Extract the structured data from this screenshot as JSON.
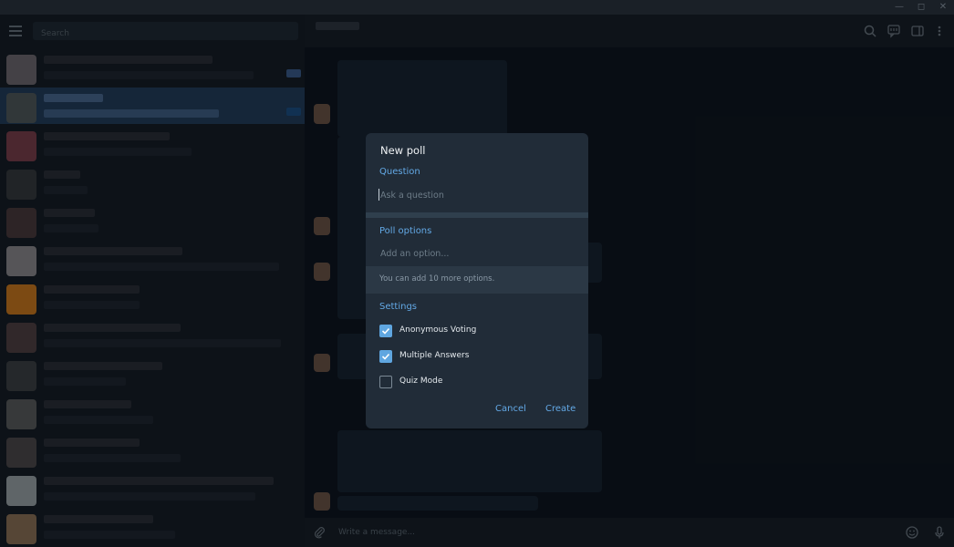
{
  "sidebar": {
    "search_placeholder": "Search"
  },
  "composer": {
    "placeholder": "Write a message..."
  },
  "dialog": {
    "title": "New poll",
    "question_label": "Question",
    "question_placeholder": "Ask a question",
    "options_label": "Poll options",
    "option_placeholder": "Add an option...",
    "options_hint": "You can add 10 more options.",
    "settings_label": "Settings",
    "settings": [
      {
        "label": "Anonymous Voting",
        "checked": true
      },
      {
        "label": "Multiple Answers",
        "checked": true
      },
      {
        "label": "Quiz Mode",
        "checked": false
      }
    ],
    "cancel_label": "Cancel",
    "create_label": "Create"
  },
  "icons": {
    "menu": "hamburger-menu-icon",
    "search": "search-icon",
    "comments": "comments-icon",
    "sidebar": "sidebar-toggle-icon",
    "more": "more-vertical-icon",
    "attach": "paperclip-icon",
    "emoji": "emoji-icon",
    "mic": "microphone-icon"
  },
  "colors": {
    "accent": "#63a9e6",
    "dialog_bg": "#212c38",
    "chat_bg": "#0e1621",
    "selected_row": "#233e5c"
  }
}
